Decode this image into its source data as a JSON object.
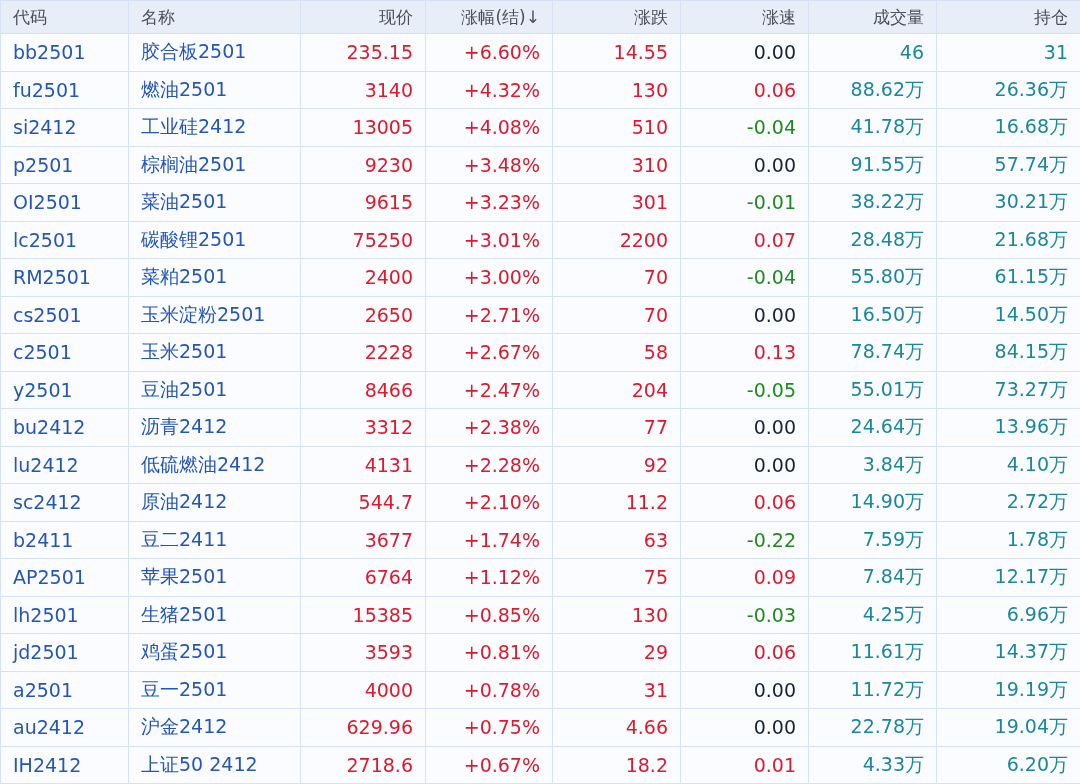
{
  "table": {
    "columns": [
      "代码",
      "名称",
      "现价",
      "涨幅(结)↓",
      "涨跌",
      "涨速",
      "成交量",
      "持仓"
    ],
    "rows": [
      {
        "code": "bb2501",
        "name": "胶合板2501",
        "price": "235.15",
        "change_pct": "+6.60%",
        "change": "14.55",
        "speed": {
          "value": "0.00",
          "color": "#1a2238"
        },
        "volume": "46",
        "open_interest": "31"
      },
      {
        "code": "fu2501",
        "name": "燃油2501",
        "price": "3140",
        "change_pct": "+4.32%",
        "change": "130",
        "speed": {
          "value": "0.06",
          "color": "#e0192b"
        },
        "volume": "88.62万",
        "open_interest": "26.36万"
      },
      {
        "code": "si2412",
        "name": "工业硅2412",
        "price": "13005",
        "change_pct": "+4.08%",
        "change": "510",
        "speed": {
          "value": "-0.04",
          "color": "#1f8a1f"
        },
        "volume": "41.78万",
        "open_interest": "16.68万"
      },
      {
        "code": "p2501",
        "name": "棕榈油2501",
        "price": "9230",
        "change_pct": "+3.48%",
        "change": "310",
        "speed": {
          "value": "0.00",
          "color": "#1a2238"
        },
        "volume": "91.55万",
        "open_interest": "57.74万"
      },
      {
        "code": "OI2501",
        "name": "菜油2501",
        "price": "9615",
        "change_pct": "+3.23%",
        "change": "301",
        "speed": {
          "value": "-0.01",
          "color": "#1f8a1f"
        },
        "volume": "38.22万",
        "open_interest": "30.21万"
      },
      {
        "code": "lc2501",
        "name": "碳酸锂2501",
        "price": "75250",
        "change_pct": "+3.01%",
        "change": "2200",
        "speed": {
          "value": "0.07",
          "color": "#e0192b"
        },
        "volume": "28.48万",
        "open_interest": "21.68万"
      },
      {
        "code": "RM2501",
        "name": "菜粕2501",
        "price": "2400",
        "change_pct": "+3.00%",
        "change": "70",
        "speed": {
          "value": "-0.04",
          "color": "#1f8a1f"
        },
        "volume": "55.80万",
        "open_interest": "61.15万"
      },
      {
        "code": "cs2501",
        "name": "玉米淀粉2501",
        "price": "2650",
        "change_pct": "+2.71%",
        "change": "70",
        "speed": {
          "value": "0.00",
          "color": "#1a2238"
        },
        "volume": "16.50万",
        "open_interest": "14.50万"
      },
      {
        "code": "c2501",
        "name": "玉米2501",
        "price": "2228",
        "change_pct": "+2.67%",
        "change": "58",
        "speed": {
          "value": "0.13",
          "color": "#e0192b"
        },
        "volume": "78.74万",
        "open_interest": "84.15万"
      },
      {
        "code": "y2501",
        "name": "豆油2501",
        "price": "8466",
        "change_pct": "+2.47%",
        "change": "204",
        "speed": {
          "value": "-0.05",
          "color": "#1f8a1f"
        },
        "volume": "55.01万",
        "open_interest": "73.27万"
      },
      {
        "code": "bu2412",
        "name": "沥青2412",
        "price": "3312",
        "change_pct": "+2.38%",
        "change": "77",
        "speed": {
          "value": "0.00",
          "color": "#1a2238"
        },
        "volume": "24.64万",
        "open_interest": "13.96万"
      },
      {
        "code": "lu2412",
        "name": "低硫燃油2412",
        "price": "4131",
        "change_pct": "+2.28%",
        "change": "92",
        "speed": {
          "value": "0.00",
          "color": "#1a2238"
        },
        "volume": "3.84万",
        "open_interest": "4.10万"
      },
      {
        "code": "sc2412",
        "name": "原油2412",
        "price": "544.7",
        "change_pct": "+2.10%",
        "change": "11.2",
        "speed": {
          "value": "0.06",
          "color": "#e0192b"
        },
        "volume": "14.90万",
        "open_interest": "2.72万"
      },
      {
        "code": "b2411",
        "name": "豆二2411",
        "price": "3677",
        "change_pct": "+1.74%",
        "change": "63",
        "speed": {
          "value": "-0.22",
          "color": "#1f8a1f"
        },
        "volume": "7.59万",
        "open_interest": "1.78万"
      },
      {
        "code": "AP2501",
        "name": "苹果2501",
        "price": "6764",
        "change_pct": "+1.12%",
        "change": "75",
        "speed": {
          "value": "0.09",
          "color": "#e0192b"
        },
        "volume": "7.84万",
        "open_interest": "12.17万"
      },
      {
        "code": "lh2501",
        "name": "生猪2501",
        "price": "15385",
        "change_pct": "+0.85%",
        "change": "130",
        "speed": {
          "value": "-0.03",
          "color": "#1f8a1f"
        },
        "volume": "4.25万",
        "open_interest": "6.96万"
      },
      {
        "code": "jd2501",
        "name": "鸡蛋2501",
        "price": "3593",
        "change_pct": "+0.81%",
        "change": "29",
        "speed": {
          "value": "0.06",
          "color": "#e0192b"
        },
        "volume": "11.61万",
        "open_interest": "14.37万"
      },
      {
        "code": "a2501",
        "name": "豆一2501",
        "price": "4000",
        "change_pct": "+0.78%",
        "change": "31",
        "speed": {
          "value": "0.00",
          "color": "#1a2238"
        },
        "volume": "11.72万",
        "open_interest": "19.19万"
      },
      {
        "code": "au2412",
        "name": "沪金2412",
        "price": "629.96",
        "change_pct": "+0.75%",
        "change": "4.66",
        "speed": {
          "value": "0.00",
          "color": "#1a2238"
        },
        "volume": "22.78万",
        "open_interest": "19.04万"
      },
      {
        "code": "IH2412",
        "name": "上证50 2412",
        "price": "2718.6",
        "change_pct": "+0.67%",
        "change": "18.2",
        "speed": {
          "value": "0.01",
          "color": "#e0192b"
        },
        "volume": "4.33万",
        "open_interest": "6.20万"
      }
    ]
  }
}
